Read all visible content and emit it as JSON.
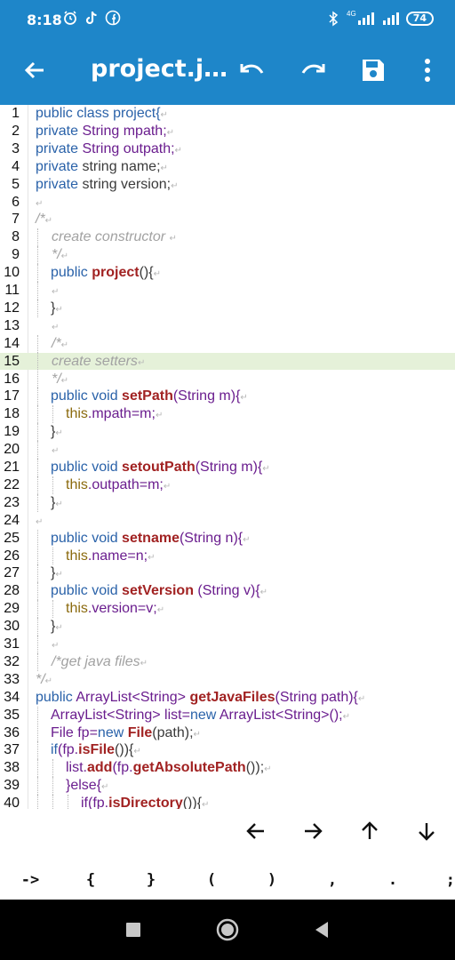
{
  "status_bar": {
    "time": "8:18",
    "network": "4G",
    "battery": "74"
  },
  "toolbar": {
    "title": "project.j…",
    "accent_color": "#1e86c9"
  },
  "editor": {
    "highlighted_line": "15",
    "lines": [
      {
        "n": "1"
      },
      {
        "n": "2"
      },
      {
        "n": "3"
      },
      {
        "n": "4"
      },
      {
        "n": "5"
      },
      {
        "n": "6"
      },
      {
        "n": "7"
      },
      {
        "n": "8"
      },
      {
        "n": "9"
      },
      {
        "n": "10"
      },
      {
        "n": "11"
      },
      {
        "n": "12"
      },
      {
        "n": "13"
      },
      {
        "n": "14"
      },
      {
        "n": "15"
      },
      {
        "n": "16"
      },
      {
        "n": "17"
      },
      {
        "n": "18"
      },
      {
        "n": "19"
      },
      {
        "n": "20"
      },
      {
        "n": "21"
      },
      {
        "n": "22"
      },
      {
        "n": "23"
      },
      {
        "n": "24"
      },
      {
        "n": "25"
      },
      {
        "n": "26"
      },
      {
        "n": "27"
      },
      {
        "n": "28"
      },
      {
        "n": "29"
      },
      {
        "n": "30"
      },
      {
        "n": "31"
      },
      {
        "n": "32"
      },
      {
        "n": "33"
      },
      {
        "n": "34"
      },
      {
        "n": "35"
      },
      {
        "n": "36"
      },
      {
        "n": "37"
      },
      {
        "n": "38"
      },
      {
        "n": "39"
      },
      {
        "n": "40"
      }
    ],
    "code": {
      "l1": [
        "public class ",
        "project",
        "{"
      ],
      "l2": [
        "private ",
        "String ",
        "mpath;"
      ],
      "l3": [
        "private ",
        "String ",
        "outpath;"
      ],
      "l4": [
        "private ",
        "string name;"
      ],
      "l5": [
        "private ",
        "string version;"
      ],
      "l7": "/*",
      "l8": "create constructor ",
      "l9": "*/",
      "l10": [
        "public ",
        "project",
        "(){"
      ],
      "l12": "}",
      "l14": "/*",
      "l15": "create setters",
      "l16": "*/",
      "l17": [
        "public void ",
        "setPath",
        "(String m){"
      ],
      "l18": [
        "this",
        ".mpath=m;"
      ],
      "l19": "}",
      "l21": [
        "public void ",
        "setoutPath",
        "(String m){"
      ],
      "l22": [
        "this",
        ".outpath=m;"
      ],
      "l23": "}",
      "l25": [
        "public void ",
        "setname",
        "(String n){"
      ],
      "l26": [
        "this",
        ".name=n;"
      ],
      "l27": "}",
      "l28": [
        "public void ",
        "setVersion",
        " (String v){"
      ],
      "l29": [
        "this",
        ".version=v;"
      ],
      "l30": "}",
      "l32": "/*get java files",
      "l33": "*/",
      "l34": [
        "public ",
        "ArrayList<String> ",
        "getJavaFiles",
        "(String path){"
      ],
      "l35": [
        "ArrayList<String> list=",
        "new ",
        "ArrayList<String>();"
      ],
      "l36": [
        "File fp=",
        "new ",
        "File",
        "(path);"
      ],
      "l37": [
        "if",
        "(fp.",
        "isFile",
        "()){"
      ],
      "l38": [
        "list.",
        "add",
        "(fp.",
        "getAbsolutePath",
        "());"
      ],
      "l39": "}else{",
      "l40": [
        "if",
        "(fp.",
        "isDirectory",
        "()){"
      ]
    }
  },
  "arrows": {
    "left": "left-arrow",
    "right": "right-arrow",
    "up": "up-arrow",
    "down": "down-arrow"
  },
  "symbols": [
    "->",
    "{",
    "}",
    "(",
    ")",
    ",",
    ".",
    ";"
  ]
}
